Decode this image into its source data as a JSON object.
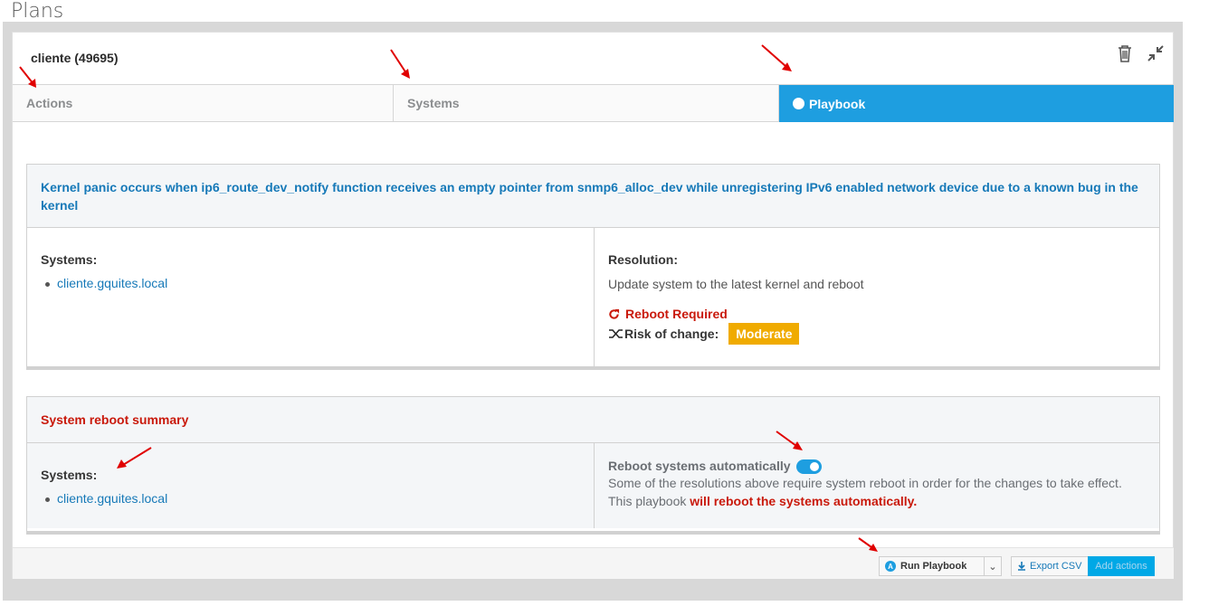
{
  "page": {
    "title": "Plans"
  },
  "plan": {
    "name": "cliente (49695)"
  },
  "header_icons": {
    "delete": "trash-icon",
    "collapse": "compress-icon"
  },
  "tabs": [
    {
      "label": "Actions",
      "active": false
    },
    {
      "label": "Systems",
      "active": false
    },
    {
      "label": "Playbook",
      "active": true
    }
  ],
  "issue": {
    "title": "Kernel panic occurs when ip6_route_dev_notify function receives an empty pointer from snmp6_alloc_dev while unregistering IPv6 enabled network device due to a known bug in the kernel",
    "systems_label": "Systems:",
    "systems": [
      "cliente.gquites.local"
    ],
    "resolution_label": "Resolution:",
    "resolution_text": "Update system to the latest kernel and reboot",
    "reboot_required": "Reboot Required",
    "risk_label": "Risk of change:",
    "risk_value": "Moderate"
  },
  "reboot_summary": {
    "title": "System reboot summary",
    "systems_label": "Systems:",
    "systems": [
      "cliente.gquites.local"
    ],
    "toggle_label": "Reboot systems automatically",
    "toggle_on": true,
    "description_prefix": "Some of the resolutions above require system reboot in order for the changes to take effect. This playbook ",
    "description_emphasis": "will reboot the systems automatically."
  },
  "footer": {
    "run_label": "Run Playbook",
    "export_label": "Export CSV",
    "add_label": "Add actions"
  },
  "colors": {
    "accent": "#1e9ee0",
    "link": "#1679b8",
    "danger": "#c9190b",
    "warning": "#f0ab00",
    "annotation": "#e00000"
  }
}
